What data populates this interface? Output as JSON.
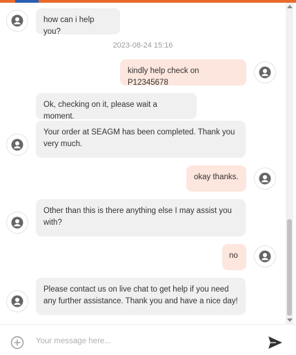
{
  "messages": {
    "m1": "how can i help you?",
    "timestamp": "2023-08-24 15:16",
    "m2": "kindly help check on P12345678",
    "m3": "Ok, checking on it, please wait a moment.",
    "m4": "Your order at SEAGM has been completed. Thank you very much.",
    "m5": "okay thanks.",
    "m6": "Other than this is there anything else I may assist you with?",
    "m7": "no",
    "m8": "Please contact us on live chat to get help if you need any further assistance. Thank you and have a nice day!"
  },
  "composer": {
    "placeholder": "Your message here..."
  },
  "icons": {
    "avatar": "user-avatar-icon",
    "add": "plus-circle-icon",
    "send": "send-icon"
  },
  "colors": {
    "accent": "#ea6a2e",
    "incoming_bubble": "#f0f0f0",
    "outgoing_bubble": "#fde6de"
  }
}
